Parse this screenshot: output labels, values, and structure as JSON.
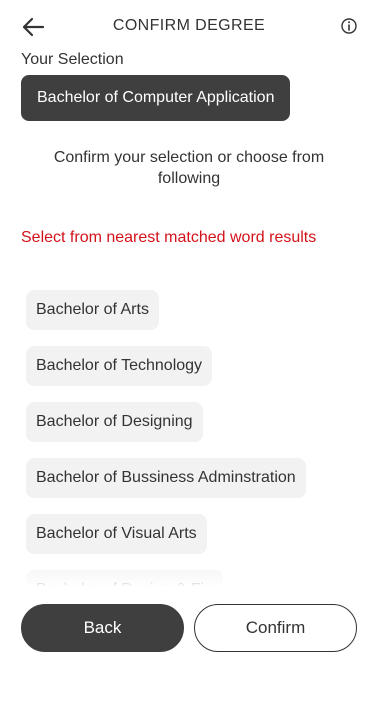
{
  "header": {
    "title": "CONFIRM DEGREE",
    "back_icon": "arrow-left-icon",
    "info_icon": "info-circle-icon"
  },
  "selection": {
    "label": "Your Selection",
    "value": "Bachelor of Computer Application"
  },
  "message": "Confirm your selection or choose from following",
  "suggestions": {
    "label": "Select from nearest matched word results",
    "items": [
      "Bachelor of Arts",
      "Bachelor of Technology",
      "Bachelor of Designing",
      "Bachelor of Bussiness Adminstration",
      "Bachelor of Visual Arts",
      "Bachelor of Design & Fin"
    ]
  },
  "buttons": {
    "back": "Back",
    "confirm": "Confirm"
  },
  "colors": {
    "dark": "#3f3f3f",
    "accent_red": "#d3131a",
    "chip_bg": "#f2f2f2"
  }
}
